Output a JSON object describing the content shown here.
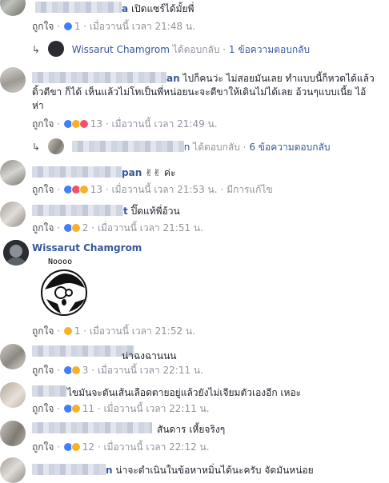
{
  "labels": {
    "like": "ถูกใจ",
    "reply": "ตอบกลับ",
    "dot": "·",
    "replied": "ได้ตอบกลับ",
    "edited": "มีการแก้ไข"
  },
  "comments": [
    {
      "name_tail": "a",
      "text": "เปิดแซร์ได้มั้ยพี่",
      "count": "1",
      "time": "เมื่อวานนี้ เวลา 21:48 น."
    },
    {
      "name_tail": "an",
      "text1": "ไปก็คนว่ะ ไม่สอยมันเลย ทำแบบนี้ก็หวดได้แล้ว",
      "text2": "ดิ้วตีขา ก็ได้ เห็นแล้วไม่โทเป็นพี่หน่อยนะจะตีขาให้เดินไม่ได้เลย อ้วนๆแบบเนี้ย ไอ้",
      "text3": "ห่า",
      "count": "13",
      "time": "เมื่อวานนี้ เวลา 21:49 น."
    },
    {
      "name_tail": "pan",
      "text": "✌✌ ค่ะ",
      "count": "13",
      "time": "เมื่อวานนี้ เวลา 21:53 น."
    },
    {
      "name_tail": "t",
      "text": "ปิ๊ดแท้พี่อ้วน",
      "count": "2",
      "time": "เมื่อวานนี้ เวลา 21:51 น."
    },
    {
      "name": "Wissarut Chamgrom",
      "sticker_text": "Noooo",
      "count": "1",
      "time": "เมื่อวานนี้ เวลา 21:52 น."
    },
    {
      "text": "น่าฉงฉานนน",
      "count": "3",
      "time": "เมื่อวานนี้ เวลา 22:11 น."
    },
    {
      "text": "ไขมันจะตันเส้นเลือดตายอยู่แล้วยังไม่เจียมตัวเองอีก เหอะ",
      "count": "11",
      "time": "เมื่อวานนี้ เวลา 22:11 น."
    },
    {
      "text": "สันดาร เหี้ยจริงๆ",
      "count": "12",
      "time": "เมื่อวานนี้ เวลา 22:12 น."
    },
    {
      "name_tail": "n",
      "text": "น่าจะดำเนินในข้อหาหมิ่นได้นะครับ จัดมันหน่อย"
    }
  ],
  "replies": [
    {
      "name": "Wissarut Chamgrom",
      "summary": "1 ข้อความตอบกลับ"
    },
    {
      "name_tail": "n",
      "summary": "6 ข้อความตอบกลับ"
    }
  ],
  "colors": {
    "link": "#365899",
    "meta": "#90949c",
    "like": "#4080ff"
  }
}
